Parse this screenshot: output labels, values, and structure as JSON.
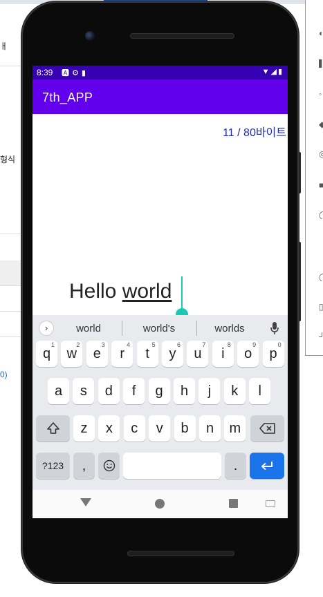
{
  "background": {
    "left_texts": [
      "ㅐ",
      "형식",
      "0)"
    ]
  },
  "statusbar": {
    "time": "8:39"
  },
  "app": {
    "title": "7th_APP",
    "byte_counter": "11 / 80바이트",
    "edit_prefix": "Hello ",
    "edit_underlined": "world"
  },
  "keyboard": {
    "suggestions": [
      "world",
      "world's",
      "worlds"
    ],
    "row1": [
      {
        "k": "q",
        "h": "1"
      },
      {
        "k": "w",
        "h": "2"
      },
      {
        "k": "e",
        "h": "3"
      },
      {
        "k": "r",
        "h": "4"
      },
      {
        "k": "t",
        "h": "5"
      },
      {
        "k": "y",
        "h": "6"
      },
      {
        "k": "u",
        "h": "7"
      },
      {
        "k": "i",
        "h": "8"
      },
      {
        "k": "o",
        "h": "9"
      },
      {
        "k": "p",
        "h": "0"
      }
    ],
    "row2": [
      "a",
      "s",
      "d",
      "f",
      "g",
      "h",
      "j",
      "k",
      "l"
    ],
    "row3": [
      "z",
      "x",
      "c",
      "v",
      "b",
      "n",
      "m"
    ],
    "symbols_key": "?123",
    "comma_key": ",",
    "period_key": "."
  },
  "colors": {
    "status_bar": "#3700b3",
    "app_bar": "#6200ee",
    "counter_text": "#1c2bb8",
    "cursor": "#1bc7b5",
    "enter_key": "#1a73e8"
  },
  "icons": [
    "notification-a-icon",
    "settings-gear-icon",
    "sd-card-icon",
    "wifi-icon",
    "signal-icon",
    "battery-icon",
    "expand-suggestions-icon",
    "mic-icon",
    "shift-icon",
    "backspace-icon",
    "emoji-icon",
    "enter-icon",
    "nav-back-icon",
    "nav-home-icon",
    "nav-recents-icon",
    "keyboard-switch-icon"
  ]
}
